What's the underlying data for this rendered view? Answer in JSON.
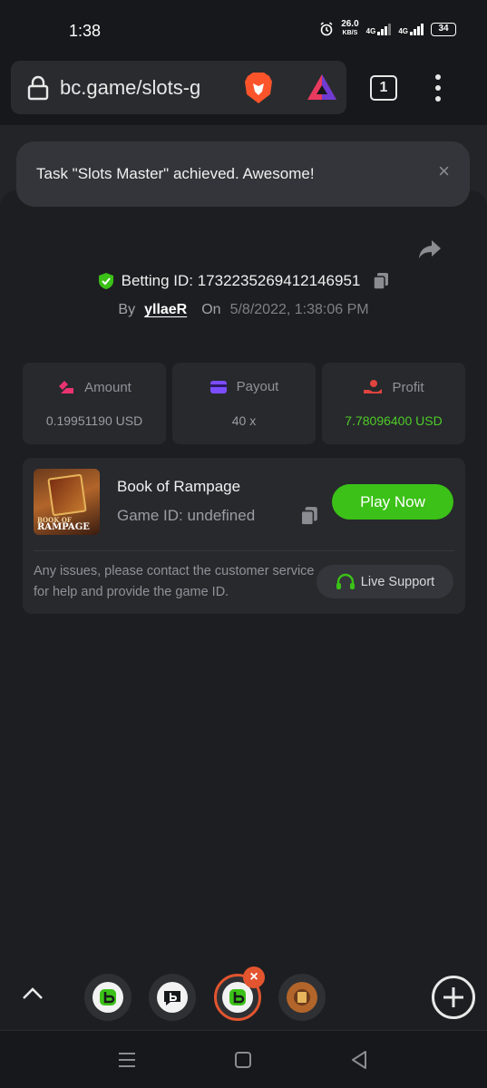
{
  "status_bar": {
    "time": "1:38",
    "net_speed": "26.0",
    "net_unit": "KB/S",
    "sig1": "4G",
    "sig2": "4G",
    "battery": "34"
  },
  "browser": {
    "url": "bc.game/slots-g",
    "tab_count": "1"
  },
  "toast": {
    "message": "Task \"Slots Master\" achieved. Awesome!",
    "close": "×"
  },
  "bet": {
    "betting_id_label": "Betting ID: 1732235269412146951",
    "by_label": "By",
    "user": "yllaeR",
    "on_label": "On",
    "date": "5/8/2022, 1:38:06 PM"
  },
  "stats": [
    {
      "label": "Amount",
      "value": "0.19951190 USD"
    },
    {
      "label": "Payout",
      "value": "40 x"
    },
    {
      "label": "Profit",
      "value": "7.78096400 USD"
    }
  ],
  "game": {
    "name": "Book of Rampage",
    "game_id": "Game ID: undefined",
    "play_label": "Play Now",
    "thumb_caption_top": "BOOK OF",
    "thumb_caption_main": "RAMPAGE",
    "issue_text": "Any issues, please contact the customer service for help and provide the game ID.",
    "support_label": "Live Support"
  },
  "tab_strip": {
    "close_badge": "×"
  },
  "colors": {
    "accent_green": "#3bc117",
    "profit_green": "#4ecc27",
    "amount_pink": "#e8336f",
    "payout_purple": "#7b4dff",
    "profit_red": "#e0443e",
    "tab_active": "#e2552f"
  },
  "icons": [
    "lock-icon",
    "brave-lion-icon",
    "brave-rewards-icon",
    "share-icon",
    "verified-shield-icon",
    "copy-icon",
    "amount-icon",
    "payout-icon",
    "profit-icon",
    "headset-icon",
    "chevron-up-icon",
    "plus-icon",
    "menu-icon",
    "home-icon",
    "back-icon"
  ]
}
